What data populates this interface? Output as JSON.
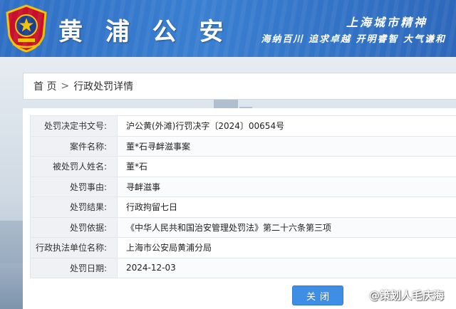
{
  "header": {
    "title": "黄 浦 公 安",
    "slogan_line1": "上海城市精神",
    "slogan_line2": "海纳百川 追求卓越 开明睿智 大气谦和"
  },
  "breadcrumb": {
    "home": "首 页",
    "separator": ">",
    "current": "行政处罚详情"
  },
  "detail": {
    "rows": [
      {
        "label": "处罚决定书文号:",
        "value": "沪公黄(外滩)行罚决字〔2024〕00654号"
      },
      {
        "label": "案件名称:",
        "value": "董*石寻衅滋事案"
      },
      {
        "label": "被处罚人姓名:",
        "value": "董*石"
      },
      {
        "label": "处罚事由:",
        "value": "寻衅滋事"
      },
      {
        "label": "处罚结果:",
        "value": "行政拘留七日"
      },
      {
        "label": "处罚依据:",
        "value": "《中华人民共和国治安管理处罚法》第二十六条第三项"
      },
      {
        "label": "行政执法单位名称:",
        "value": "上海市公安局黄浦分局"
      },
      {
        "label": "处罚日期:",
        "value": "2024-12-03"
      }
    ]
  },
  "actions": {
    "close_label": "关闭"
  },
  "watermark": {
    "text": "@策划人毛庆海"
  },
  "colors": {
    "header_blue": "#3a7fd2",
    "button_blue": "#3e8ee6",
    "label_bg": "#eff1f4"
  }
}
